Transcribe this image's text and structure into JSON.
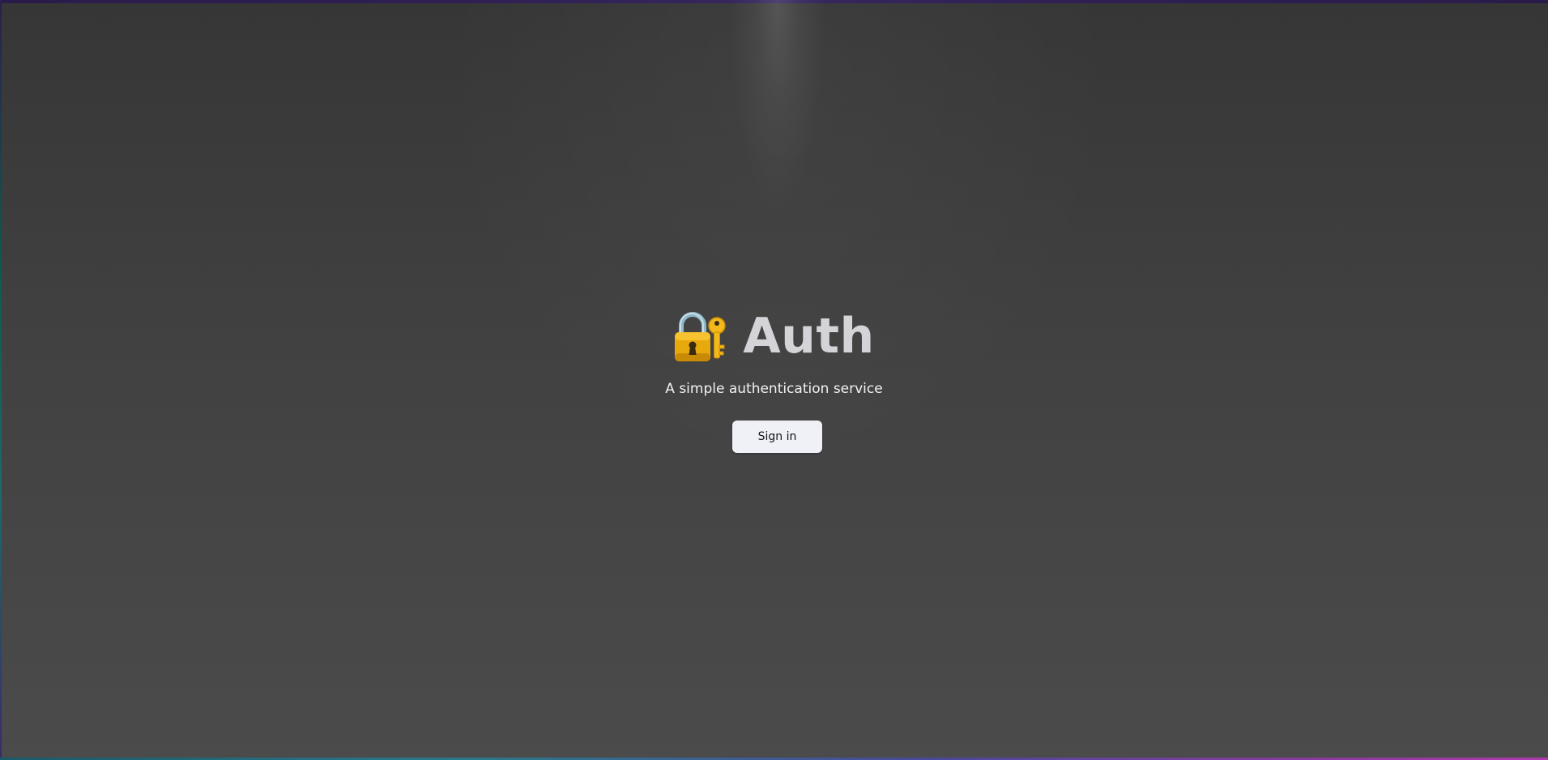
{
  "app": {
    "title": "Auth",
    "icon": "locked-with-key-icon",
    "subtitle": "A simple authentication service"
  },
  "actions": {
    "sign_in_label": "Sign in"
  },
  "colors": {
    "background_top": "#363636",
    "background_bottom": "#4b4b4b",
    "title_text": "#d4d4d8",
    "button_bg": "#f0f1f6",
    "button_text": "#111318",
    "edge_top": "#2a1b4a"
  }
}
